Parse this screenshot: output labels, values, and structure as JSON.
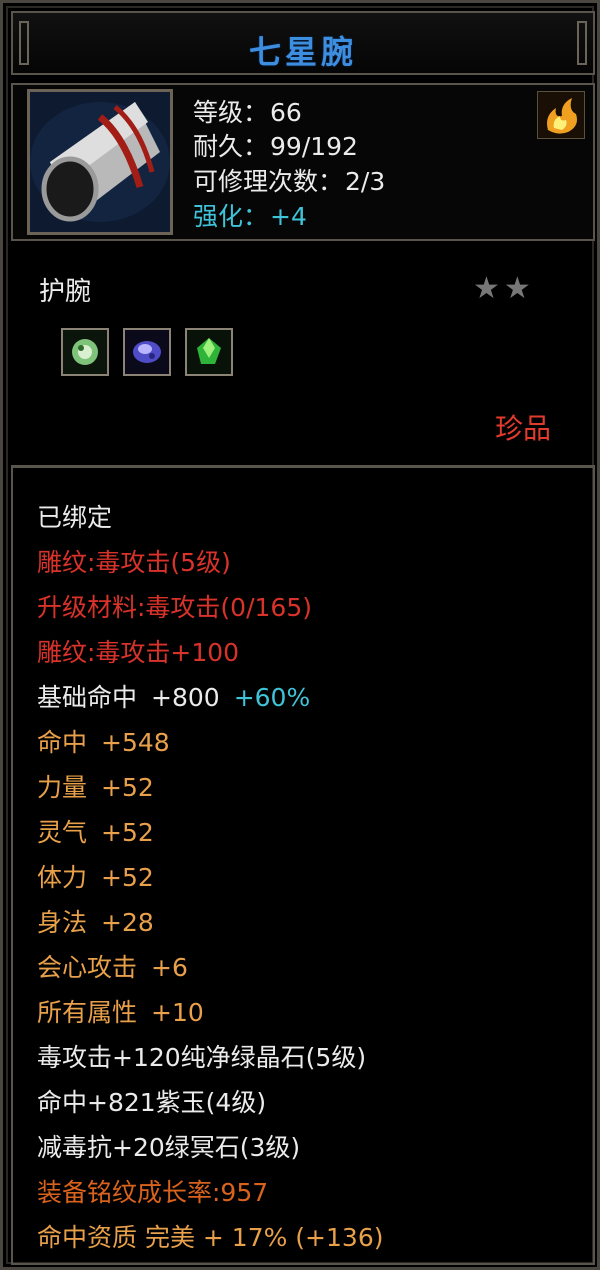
{
  "title": "七星腕",
  "header": {
    "level_label": "等级：",
    "level_value": "66",
    "durability_label": "耐久：",
    "durability_value": "99/192",
    "repair_label": "可修理次数：",
    "repair_value": "2/3",
    "enhance_label": "强化：",
    "enhance_value": "+4"
  },
  "type": "护腕",
  "stars": {
    "filled": 0,
    "total": 2
  },
  "rarity": "珍品",
  "gems": [
    "green-gem-icon",
    "purple-gem-icon",
    "emerald-gem-icon"
  ],
  "attributes": {
    "bound": "已绑定",
    "engrave1": "雕纹:毒攻击(5级)",
    "upgrade_material": "升级材料:毒攻击(0/165)",
    "engrave2": "雕纹:毒攻击+100",
    "base_hit_label": "基础命中",
    "base_hit_value": "+800",
    "base_hit_bonus": "+60%",
    "hit_label": "命中",
    "hit_value": "+548",
    "str_label": "力量",
    "str_value": "+52",
    "spirit_label": "灵气",
    "spirit_value": "+52",
    "vit_label": "体力",
    "vit_value": "+52",
    "agi_label": "身法",
    "agi_value": "+28",
    "crit_label": "会心攻击",
    "crit_value": "+6",
    "all_label": "所有属性",
    "all_value": "+10",
    "gem1": "毒攻击+120纯净绿晶石(5级)",
    "gem2": "命中+821紫玉(4级)",
    "gem3": "减毒抗+20绿冥石(3级)",
    "growth": "装备铭纹成长率:957",
    "quality": "命中资质 完美 + 17% (+136)"
  },
  "colors": {
    "title": "#3e8ee0",
    "engrave": "#d8322a",
    "stat": "#e8a04a",
    "enhance": "#3fc3d8",
    "growth": "#d9621c",
    "rarity": "#e23b2e"
  }
}
